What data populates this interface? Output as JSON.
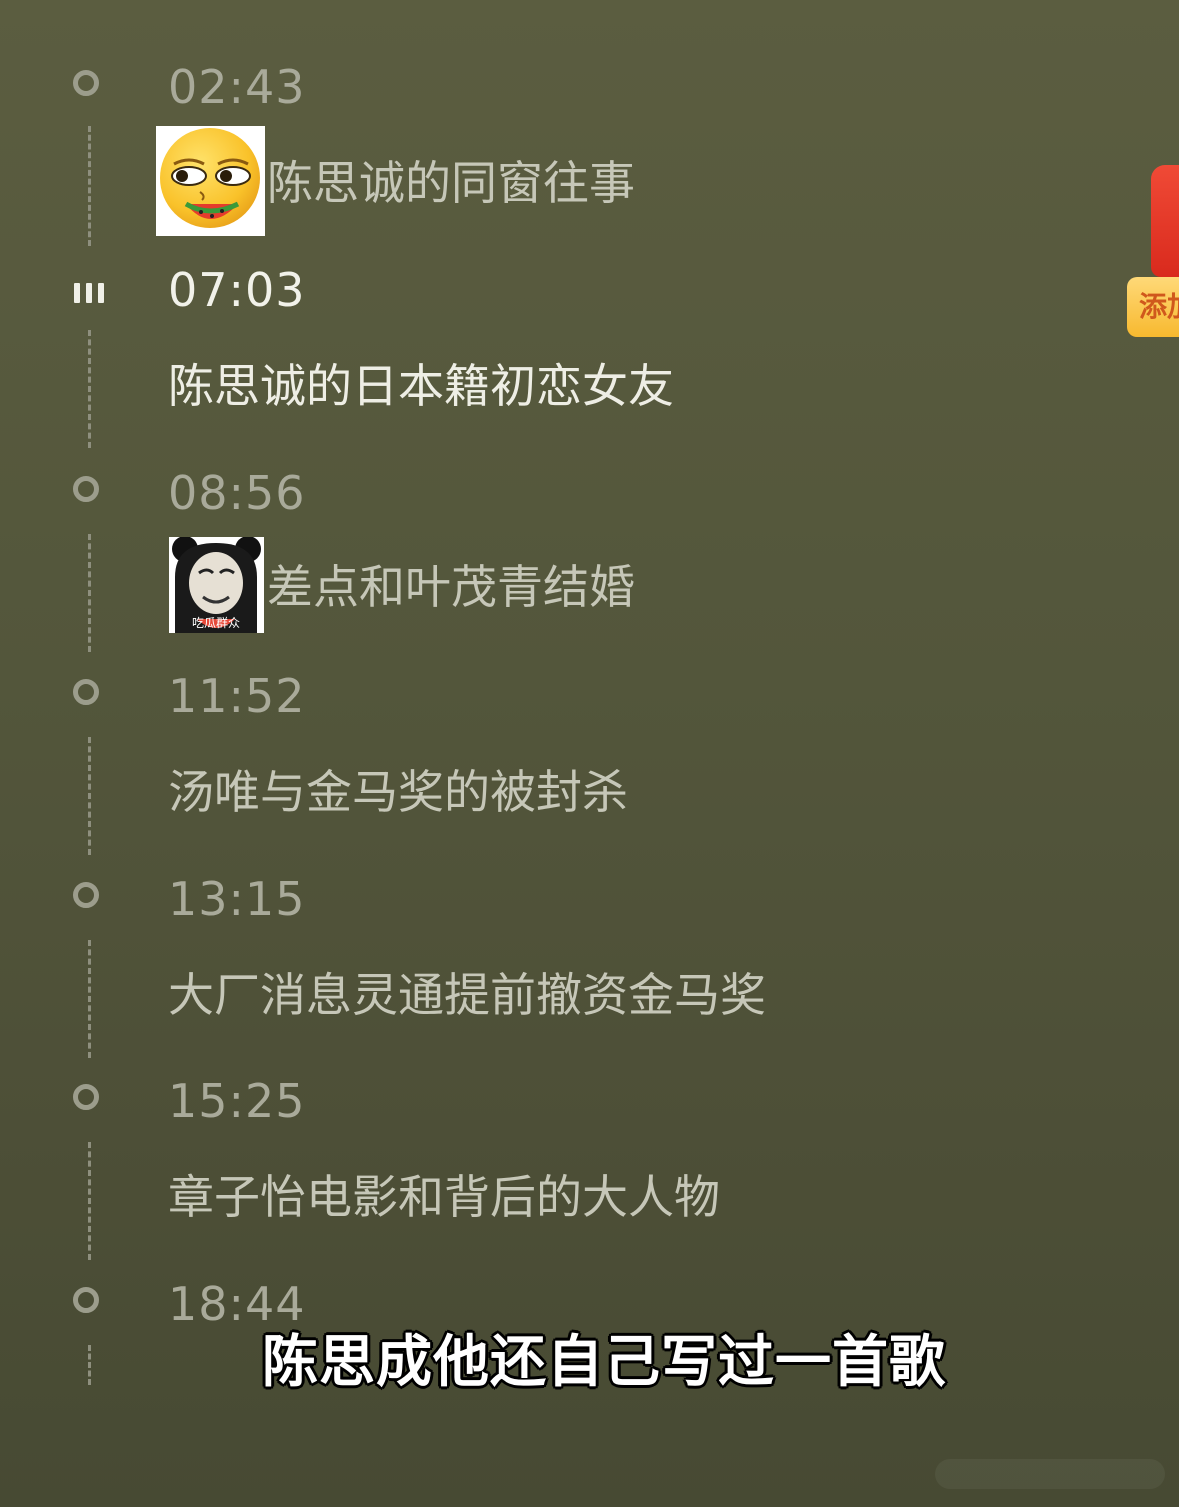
{
  "chapters": [
    {
      "time": "02:43",
      "title": "陈思诚的同窗往事",
      "sticker": "smirk-watermelon-emoji",
      "state": "idle"
    },
    {
      "time": "07:03",
      "title": "陈思诚的日本籍初恋女友",
      "sticker": null,
      "state": "playing"
    },
    {
      "time": "08:56",
      "title": "差点和叶茂青结婚",
      "sticker": "panda-meme-watermelon",
      "state": "idle"
    },
    {
      "time": "11:52",
      "title": "汤唯与金马奖的被封杀",
      "sticker": null,
      "state": "idle"
    },
    {
      "time": "13:15",
      "title": "大厂消息灵通提前撤资金马奖",
      "sticker": null,
      "state": "idle"
    },
    {
      "time": "15:25",
      "title": "章子怡电影和背后的大人物",
      "sticker": null,
      "state": "idle"
    },
    {
      "time": "18:44",
      "title": "",
      "sticker": null,
      "state": "idle"
    }
  ],
  "panda_sticker_caption": "吃瓜群众",
  "side_badge": {
    "label": "添加"
  },
  "subtitle": "陈思成他还自己写过一首歌",
  "icons": {
    "idle_marker": "circle-icon",
    "playing_marker": "playing-bars-icon",
    "red_packet": "red-packet-icon"
  },
  "colors": {
    "background": "#55583c",
    "active_text": "#f2f2ea",
    "inactive_text": "#a9aa9a",
    "badge": "#f7b92f",
    "red_packet": "#e0321f"
  }
}
